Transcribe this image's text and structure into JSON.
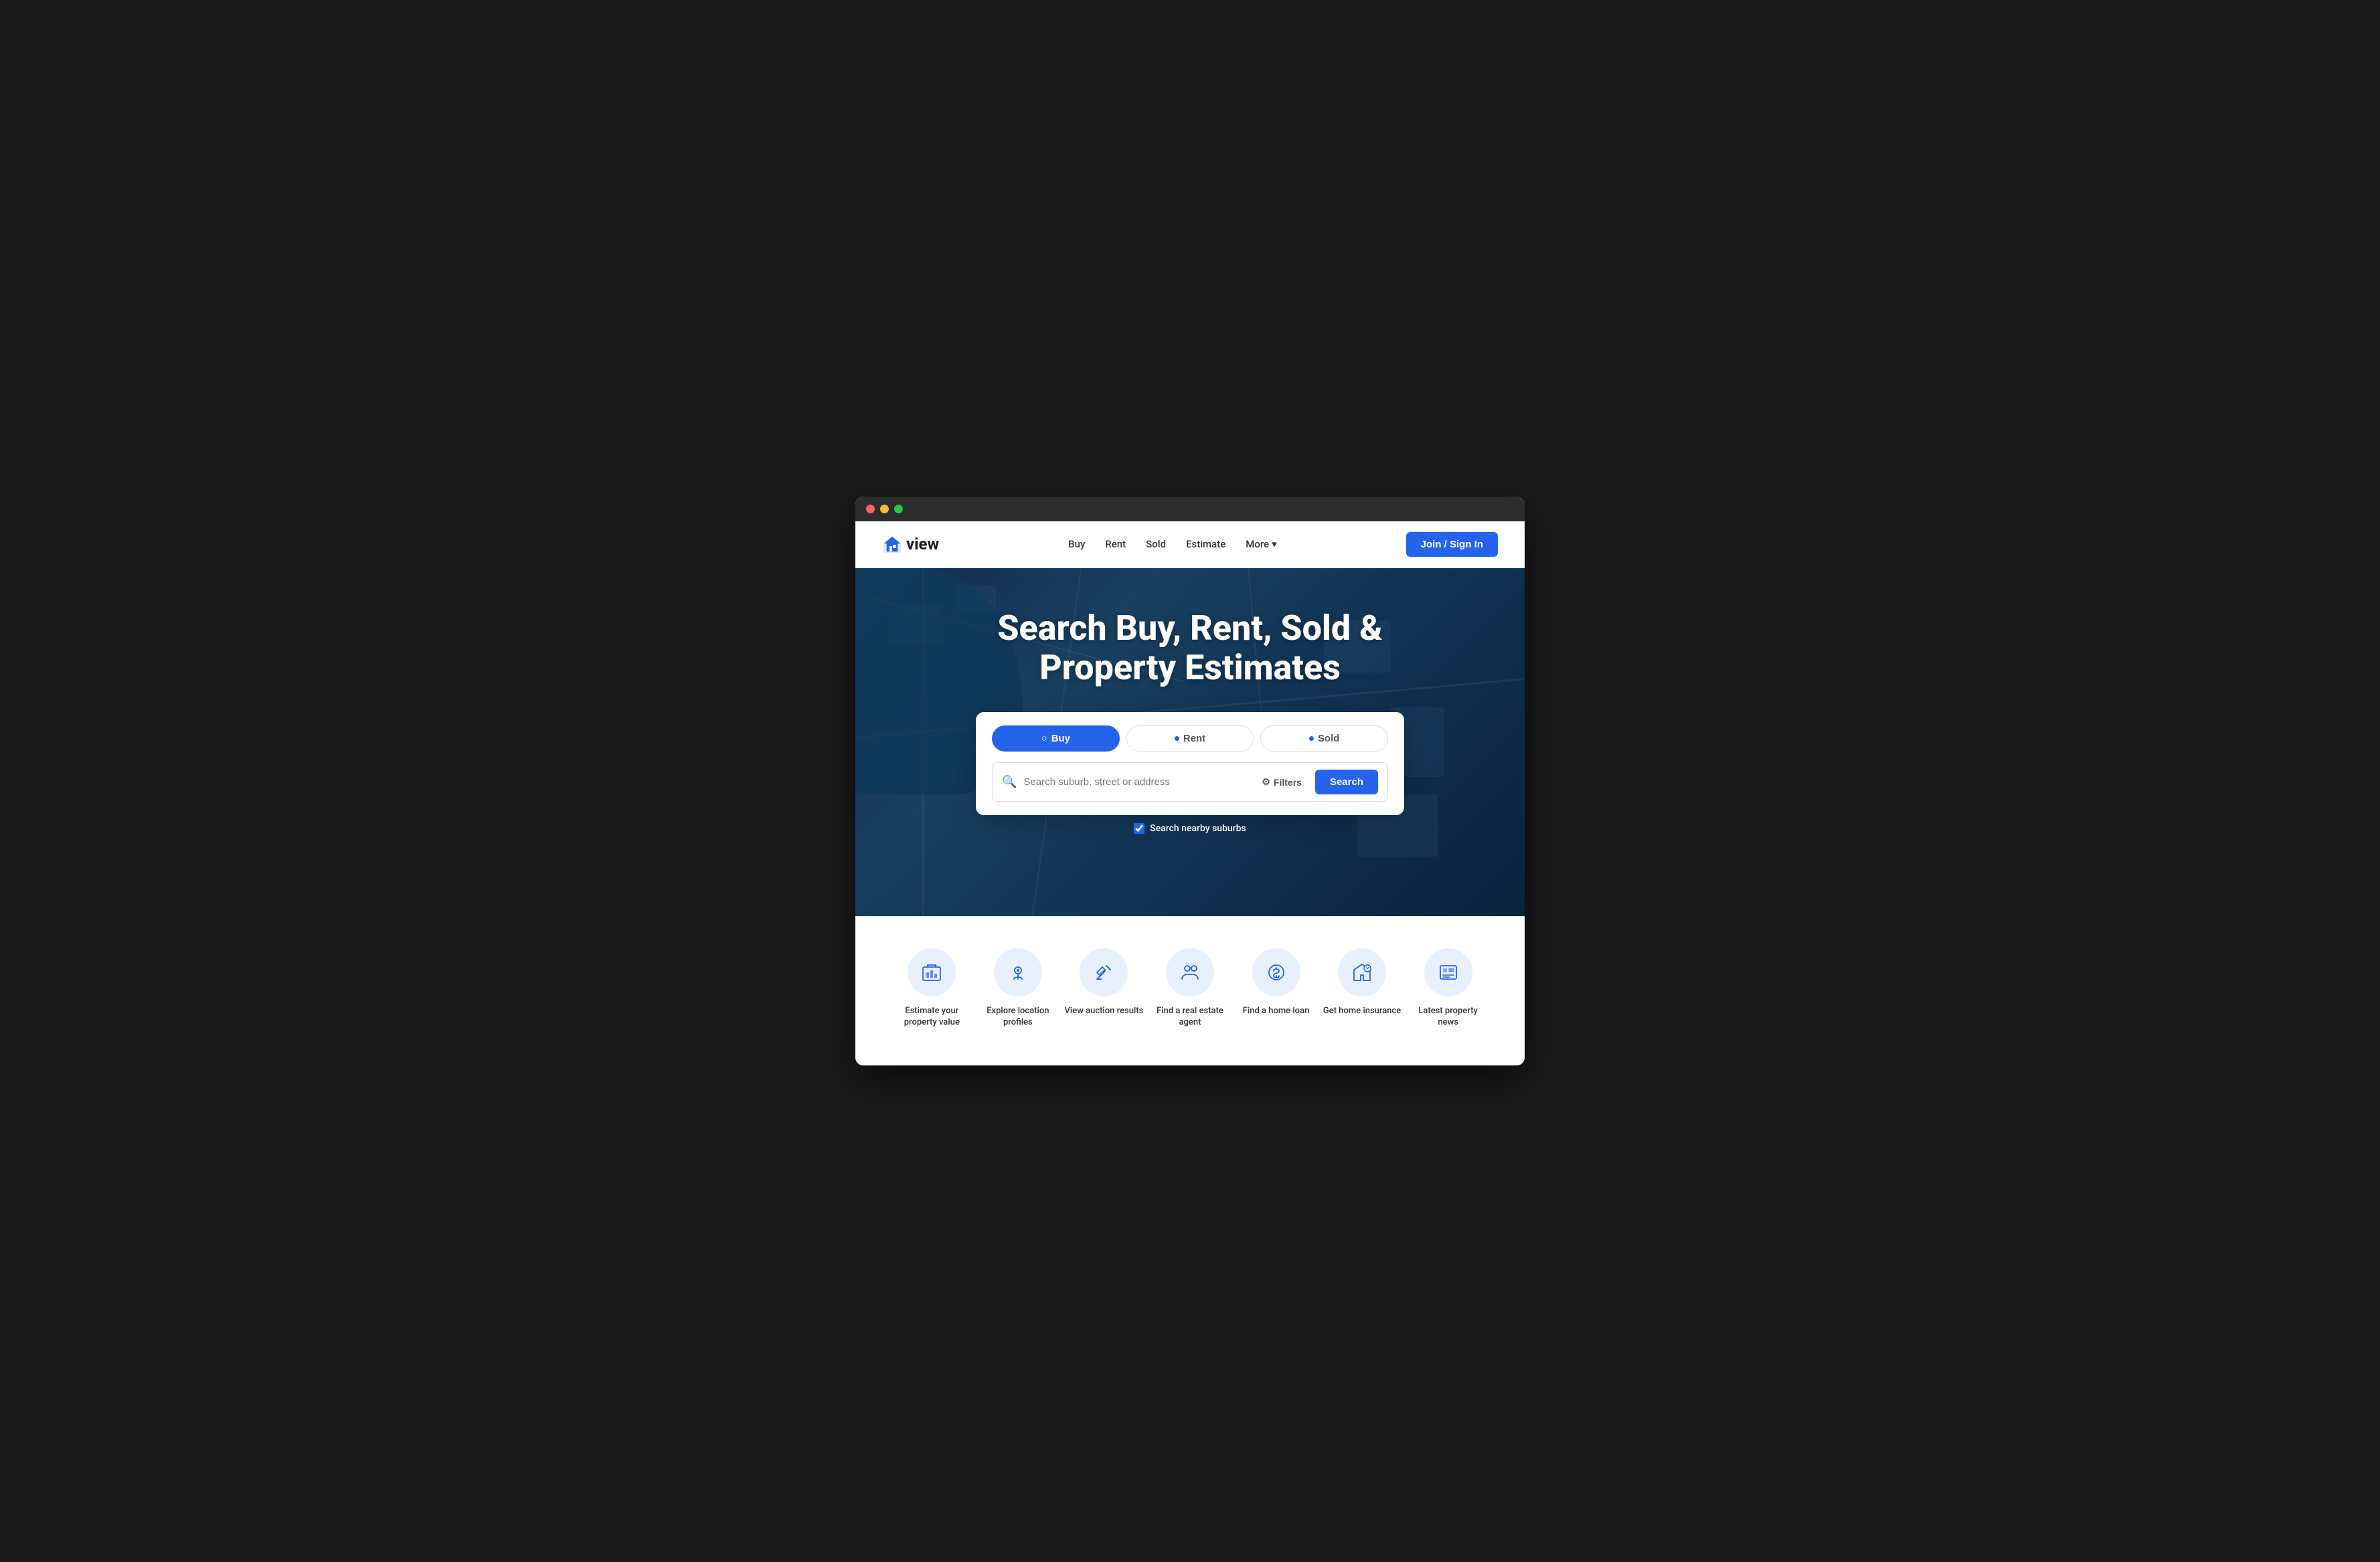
{
  "browser": {
    "dots": [
      "red",
      "yellow",
      "green"
    ]
  },
  "navbar": {
    "logo_text": "view",
    "nav_links": [
      {
        "label": "Buy",
        "id": "buy"
      },
      {
        "label": "Rent",
        "id": "rent"
      },
      {
        "label": "Sold",
        "id": "sold"
      },
      {
        "label": "Estimate",
        "id": "estimate"
      },
      {
        "label": "More",
        "id": "more",
        "has_arrow": true
      }
    ],
    "join_label": "Join / Sign In"
  },
  "hero": {
    "title_line1": "Search Buy, Rent, Sold &",
    "title_line2": "Property Estimates"
  },
  "search": {
    "tabs": [
      {
        "label": "Buy",
        "active": true
      },
      {
        "label": "Rent",
        "active": false
      },
      {
        "label": "Sold",
        "active": false
      }
    ],
    "placeholder": "Search suburb, street or address",
    "filters_label": "Filters",
    "search_label": "Search",
    "nearby_label": "Search nearby suburbs"
  },
  "quick_links": [
    {
      "label": "Estimate your property value",
      "icon": "🏠",
      "id": "estimate-value"
    },
    {
      "label": "Explore location profiles",
      "icon": "📍",
      "id": "explore-location"
    },
    {
      "label": "View auction results",
      "icon": "⚖️",
      "id": "auction-results"
    },
    {
      "label": "Find a real estate agent",
      "icon": "👥",
      "id": "find-agent"
    },
    {
      "label": "Find a home loan",
      "icon": "💰",
      "id": "home-loan"
    },
    {
      "label": "Get home insurance",
      "icon": "🏡",
      "id": "home-insurance"
    },
    {
      "label": "Latest property news",
      "icon": "📰",
      "id": "property-news"
    }
  ]
}
